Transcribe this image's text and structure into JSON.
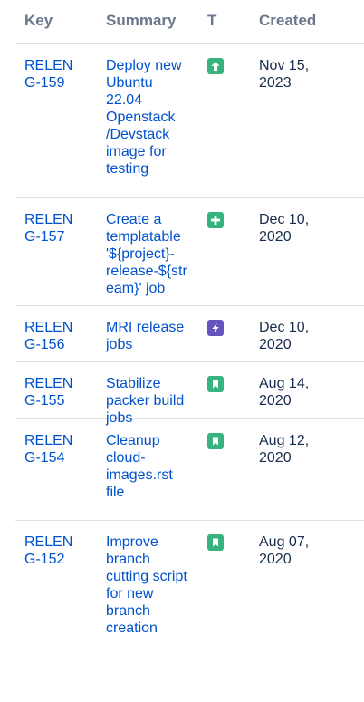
{
  "columns": {
    "key": "Key",
    "summary": "Summary",
    "type": "T",
    "created": "Created"
  },
  "rows": [
    {
      "key_line1": "RELEN",
      "key_line2": "G-159",
      "summary_lines": [
        "Deploy new",
        "Ubuntu",
        "22.04",
        "Openstack",
        "/Devstack",
        "image for",
        "testing"
      ],
      "type_icon": "improvement-icon",
      "type_color": "#36b37e",
      "created_line1": "Nov 15,",
      "created_line2": "2023"
    },
    {
      "key_line1": "RELEN",
      "key_line2": "G-157",
      "summary_lines": [
        "Create a",
        "templatable",
        "'${project}-",
        "release-${str",
        "eam}' job"
      ],
      "type_icon": "new-feature-icon",
      "type_color": "#36b37e",
      "created_line1": "Dec 10,",
      "created_line2": "2020"
    },
    {
      "key_line1": "RELEN",
      "key_line2": "G-156",
      "summary_lines": [
        "MRI release",
        "jobs"
      ],
      "type_icon": "epic-icon",
      "type_color": "#6554c0",
      "created_line1": "Dec 10,",
      "created_line2": "2020"
    },
    {
      "key_line1": "RELEN",
      "key_line2": "G-155",
      "summary_lines": [
        "Stabilize",
        "packer build",
        "jobs"
      ],
      "type_icon": "story-icon",
      "type_color": "#36b37e",
      "created_line1": "Aug 14,",
      "created_line2": "2020"
    },
    {
      "key_line1": "RELEN",
      "key_line2": "G-154",
      "summary_lines": [
        "Cleanup",
        "cloud-",
        "images.rst",
        "file"
      ],
      "type_icon": "story-icon",
      "type_color": "#36b37e",
      "created_line1": "Aug 12,",
      "created_line2": "2020"
    },
    {
      "key_line1": "RELEN",
      "key_line2": "G-152",
      "summary_lines": [
        "Improve",
        "branch",
        "cutting script",
        "for new",
        "branch",
        "creation"
      ],
      "type_icon": "story-icon",
      "type_color": "#36b37e",
      "created_line1": "Aug 07,",
      "created_line2": "2020"
    }
  ]
}
